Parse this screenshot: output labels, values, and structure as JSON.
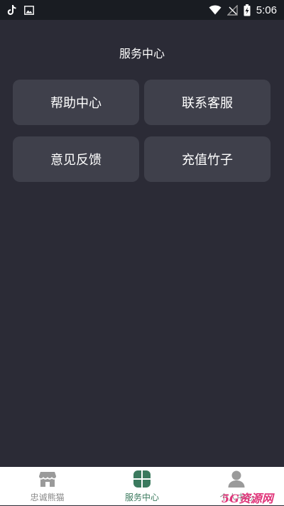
{
  "status_bar": {
    "time": "5:06",
    "icons": [
      "tiktok-icon",
      "image-icon",
      "wifi-icon",
      "no-signal-icon",
      "battery-charging-icon"
    ]
  },
  "page": {
    "title": "服务中心"
  },
  "services": [
    {
      "label": "帮助中心"
    },
    {
      "label": "联系客服"
    },
    {
      "label": "意见反馈"
    },
    {
      "label": "充值竹子"
    }
  ],
  "bottom_nav": {
    "items": [
      {
        "label": "忠诚熊猫",
        "icon": "shop-icon",
        "active": false
      },
      {
        "label": "服务中心",
        "icon": "clover-icon",
        "active": true
      },
      {
        "label": "个人中心",
        "icon": "person-icon",
        "active": false
      }
    ]
  },
  "watermark": "5G资源网",
  "colors": {
    "background": "#2b2b36",
    "tile": "#3f404b",
    "active": "#3b7a5e",
    "inactive": "#888888",
    "watermark": "#e0357a"
  }
}
